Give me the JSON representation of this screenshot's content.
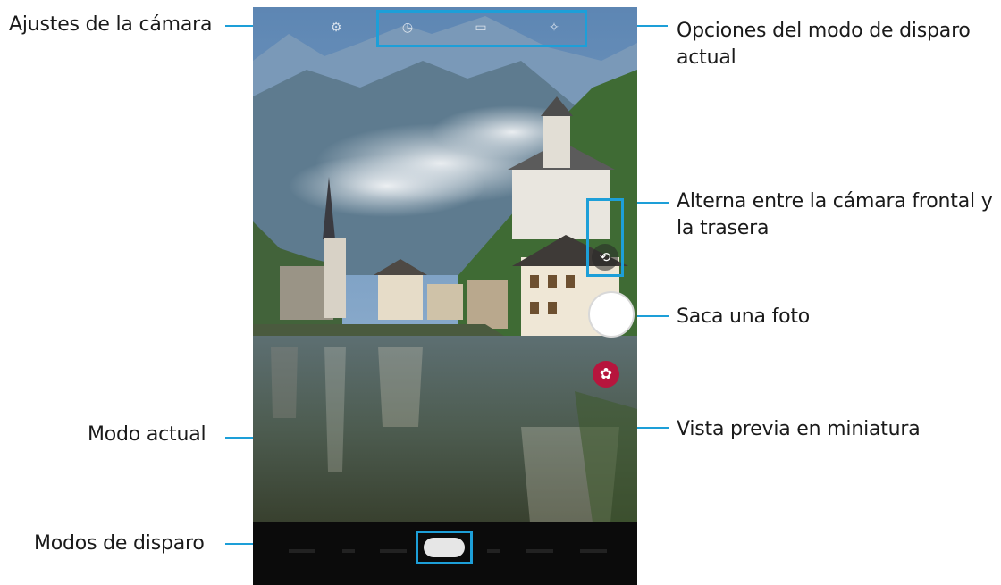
{
  "labels": {
    "camera_settings": "Ajustes de la cámara",
    "shooting_mode_options": "Opciones del modo de disparo actual",
    "switch_camera": "Alterna entre la cámara frontal y la trasera",
    "take_photo": "Saca una foto",
    "thumbnail_preview": "Vista previa en miniatura",
    "current_mode": "Modo actual",
    "shooting_modes": "Modos de disparo"
  },
  "icons": {
    "settings": "gear-icon",
    "flash": "flash-icon",
    "timer": "timer-icon",
    "ratio": "aspect-ratio-icon",
    "effects": "magic-wand-icon",
    "switch": "camera-switch-icon",
    "thumbnail": "gallery-thumbnail-icon"
  },
  "colors": {
    "callout_line": "#1d9fd8",
    "thumbnail_bg": "#b7153d",
    "mode_bar": "#0b0b0b"
  }
}
